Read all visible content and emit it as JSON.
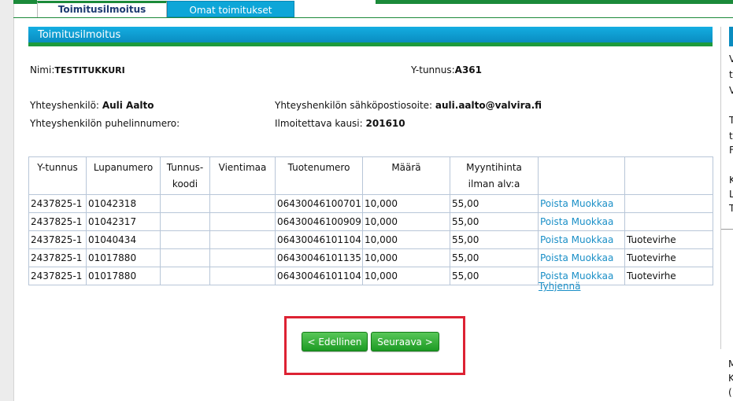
{
  "tabs": [
    {
      "label": "Toimitusilmoitus",
      "active": true
    },
    {
      "label": "Omat toimitukset",
      "active": false
    }
  ],
  "header": {
    "title": "Toimitusilmoitus"
  },
  "info": {
    "nimi_label": "Nimi:",
    "nimi_value": "TESTITUKKURI",
    "ytunnus_label": "Y-tunnus:",
    "ytunnus_value": "A361",
    "yhteyshenkilo_label": "Yhteyshenkilö:",
    "yhteyshenkilo_value": "Auli Aalto",
    "email_label": "Yhteyshenkilön sähköpostiosoite:",
    "email_value": "auli.aalto@valvira.fi",
    "puhelin_label": "Yhteyshenkilön puhelinnumero:",
    "kausi_label": "Ilmoitettava kausi:",
    "kausi_value": "201610"
  },
  "table": {
    "headers": [
      "Y-tunnus",
      "Lupanumero",
      "Tunnus-koodi",
      "Vientimaa",
      "Tuotenumero",
      "Määrä",
      "Myyntihinta ilman alv:a",
      "",
      ""
    ],
    "rows": [
      {
        "ytunnus": "2437825-1",
        "lupanumero": "01042318",
        "tunnuskoodi": "",
        "vientimaa": "",
        "tuotenumero": "06430046100701",
        "maara": "10,000",
        "hinta": "55,00",
        "poista": "Poista",
        "muokkaa": "Muokkaa",
        "virhe": ""
      },
      {
        "ytunnus": "2437825-1",
        "lupanumero": "01042317",
        "tunnuskoodi": "",
        "vientimaa": "",
        "tuotenumero": "06430046100909",
        "maara": "10,000",
        "hinta": "55,00",
        "poista": "Poista",
        "muokkaa": "Muokkaa",
        "virhe": ""
      },
      {
        "ytunnus": "2437825-1",
        "lupanumero": "01040434",
        "tunnuskoodi": "",
        "vientimaa": "",
        "tuotenumero": "06430046101104",
        "maara": "10,000",
        "hinta": "55,00",
        "poista": "Poista",
        "muokkaa": "Muokkaa",
        "virhe": "Tuotevirhe"
      },
      {
        "ytunnus": "2437825-1",
        "lupanumero": "01017880",
        "tunnuskoodi": "",
        "vientimaa": "",
        "tuotenumero": "06430046101135",
        "maara": "10,000",
        "hinta": "55,00",
        "poista": "Poista",
        "muokkaa": "Muokkaa",
        "virhe": "Tuotevirhe"
      },
      {
        "ytunnus": "2437825-1",
        "lupanumero": "01017880",
        "tunnuskoodi": "",
        "vientimaa": "",
        "tuotenumero": "06430046101104",
        "maara": "10,000",
        "hinta": "55,00",
        "poista": "Poista",
        "muokkaa": "Muokkaa",
        "virhe": "Tuotevirhe"
      }
    ]
  },
  "tyhjenna_label": "Tyhjennä",
  "buttons": {
    "prev_label": "< Edellinen",
    "next_label": "Seuraava >"
  },
  "right_panel_fragments": [
    "V",
    "t",
    "V",
    "T",
    "t",
    "F",
    "K",
    "L",
    "T"
  ],
  "right_bottom_fragments": [
    "M",
    "K",
    "("
  ],
  "colors": {
    "brand_green": "#1b8a3a",
    "header_blue": "#0a8cc0",
    "link_blue": "#1a8fc7",
    "highlight_red": "#dd2233"
  }
}
